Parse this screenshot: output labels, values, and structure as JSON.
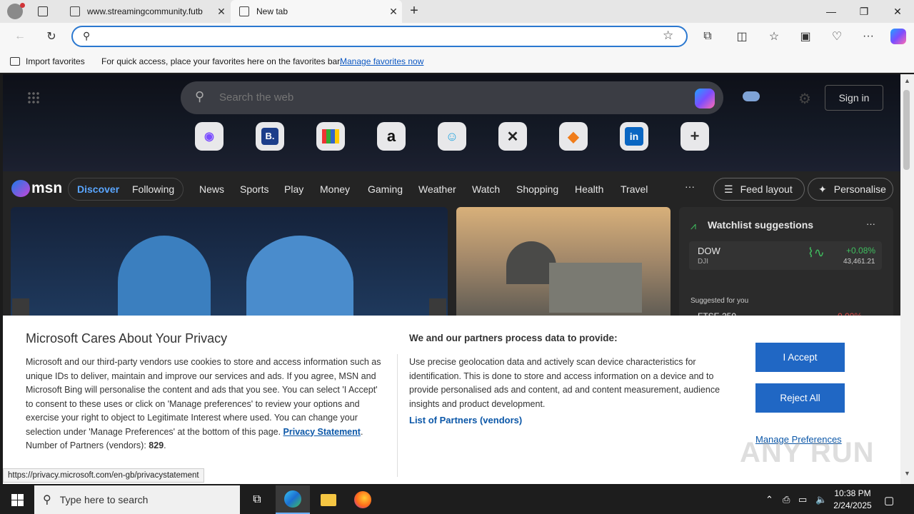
{
  "browser": {
    "tabs": [
      {
        "title": "www.streamingcommunity.futb",
        "active": false
      },
      {
        "title": "New tab",
        "active": true
      }
    ],
    "address": {
      "value": "",
      "placeholder": ""
    },
    "favorites_bar": {
      "import_label": "Import favorites",
      "message": "For quick access, place your favorites here on the favorites bar.",
      "manage_link": "Manage favorites now"
    }
  },
  "msn": {
    "search_placeholder": "Search the web",
    "sign_in": "Sign in",
    "logo": "msn",
    "nav": {
      "discover": "Discover",
      "following": "Following",
      "items": [
        "News",
        "Sports",
        "Play",
        "Money",
        "Gaming",
        "Weather",
        "Watch",
        "Shopping",
        "Health",
        "Travel"
      ],
      "more": "···",
      "feed_layout": "Feed layout",
      "personalise": "Personalise"
    },
    "watchlist": {
      "title": "Watchlist suggestions",
      "more": "···",
      "stock": {
        "symbol": "DOW",
        "index": "DJI",
        "change": "+0.08%",
        "value": "43,461.21"
      },
      "suggested": "Suggested for you",
      "next_symbol": "FTSE 250",
      "next_change": "-0.00%"
    }
  },
  "privacy": {
    "title": "Microsoft Cares About Your Privacy",
    "body_main": "Microsoft and our third-party vendors use cookies to store and access information such as unique IDs to deliver, maintain and improve our services and ads. If you agree, MSN and Microsoft Bing will personalise the content and ads that you see. You can select 'I Accept' to consent to these uses or click on 'Manage preferences' to review your options and exercise your right to object to Legitimate Interest where used.  You can change your selection under 'Manage Preferences' at the bottom of this page. ",
    "privacy_link": "Privacy Statement",
    "partners_count_label": "Number of Partners (vendors): ",
    "partners_count": "829",
    "data_title": "We and our partners process data to provide:",
    "data_body": "Use precise geolocation data and actively scan device characteristics for identification. This is done to store and access information on a device and to provide personalised ads and content, ad and content measurement, audience insights and product development.",
    "partners_link": "List of Partners (vendors)",
    "accept": "I Accept",
    "reject": "Reject All",
    "manage": "Manage Preferences"
  },
  "status_url": "https://privacy.microsoft.com/en-gb/privacystatement",
  "watermark": "ANY RUN",
  "taskbar": {
    "search_placeholder": "Type here to search",
    "time": "10:38 PM",
    "date": "2/24/2025"
  },
  "colors": {
    "accent": "#2067c4",
    "link": "#0b57a8",
    "taskbar": "#1d1d1d"
  }
}
